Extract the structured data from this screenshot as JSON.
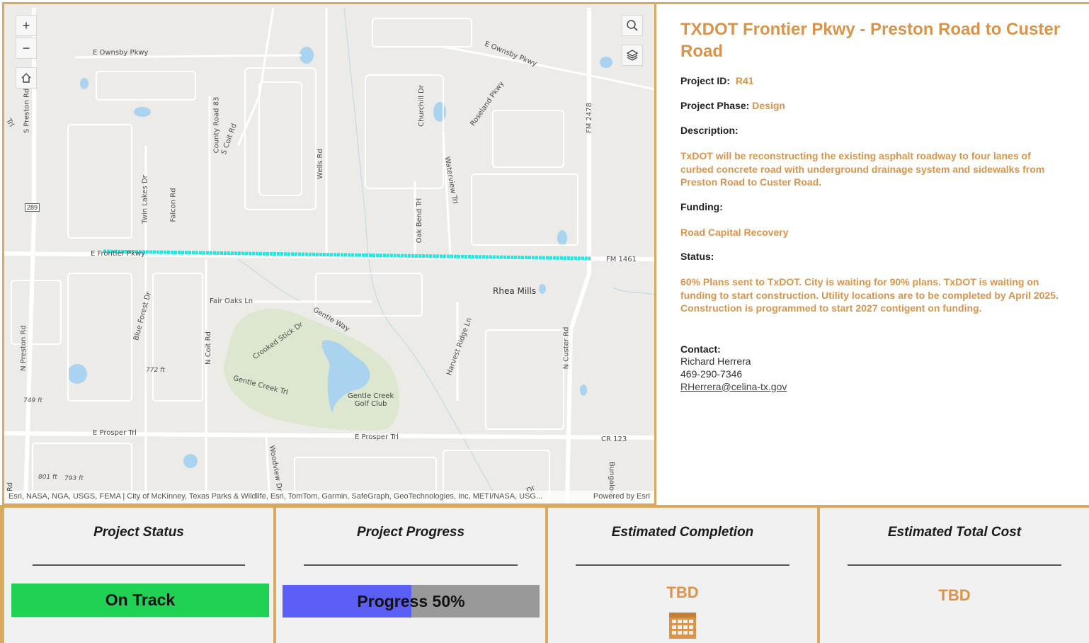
{
  "map": {
    "zoom_in_label": "+",
    "zoom_out_label": "−",
    "labels": {
      "e_ownsby_west": "E Ownsby Pkwy",
      "e_ownsby_east": "E Ownsby Pkwy",
      "s_preston": "S Preston Rd",
      "n_preston": "N Preston Rd",
      "county_road_83": "County Road 83",
      "s_coit": "S Coit Rd",
      "wells": "Wells Rd",
      "churchill": "Churchill Dr",
      "roseland": "Roseland Pkwy",
      "waterview": "Waterview Trl",
      "fm2478": "FM 2478",
      "twin_lakes": "Twin Lakes Dr",
      "falcon": "Falcon Rd",
      "oak_bend": "Oak Bend Trl",
      "e_frontier": "E Frontier Pkwy",
      "fm1461": "FM 1461",
      "rhea_mills": "Rhea Mills",
      "fair_oaks": "Fair Oaks Ln",
      "gentle_way": "Gentle Way",
      "blue_forest": "Blue Forest Dr",
      "harvest_ridge": "Harvest Ridge Ln",
      "n_custer": "N Custer Rd",
      "crooked_stick": "Crooked Stick Dr",
      "n_coit": "N Coit Rd",
      "gentle_creek_trl": "Gentle Creek Trl",
      "golf_club_1": "Gentle Creek",
      "golf_club_2": "Golf Club",
      "elev_772": "772 ft",
      "elev_749": "749 ft",
      "elev_801": "801 ft",
      "elev_793": "793 ft",
      "e_prosper_west": "E Prosper Trl",
      "e_prosper_east": "E Prosper Trl",
      "cr123": "CR 123",
      "woodview": "Woodview Dr",
      "bungalow": "Bungalow",
      "shield_289": "289",
      "trl_edge": "Trl",
      "rd_edge": "Rd",
      "dr_edge": "Dr"
    },
    "attribution_left": "Esri, NASA, NGA, USGS, FEMA | City of McKinney, Texas Parks & Wildlife, Esri, TomTom, Garmin, SafeGraph, GeoTechnologies, Inc, METI/NASA, USG...",
    "attribution_right": "Powered by Esri"
  },
  "details": {
    "title": "TXDOT Frontier Pkwy - Preston Road to Custer Road",
    "project_id_label": "Project ID:",
    "project_id": "R41",
    "phase_label": "Project Phase:",
    "phase": "Design",
    "description_label": "Description:",
    "description": "TxDOT will be reconstructing the existing asphalt roadway to four lanes of curbed concrete road with underground drainage system and sidewalks from Preston Road to Custer Road.",
    "funding_label": "Funding:",
    "funding": "Road Capital Recovery",
    "status_label": "Status:",
    "status": "60% Plans sent to TxDOT. City is waiting for 90% plans. TxDOT is waiting on funding to start construction. Utility locations are to be completed by April 2025. Construction is programmed to start 2027 contigent on funding.",
    "contact_label": "Contact:",
    "contact_name": "Richard Herrera",
    "contact_phone": "469-290-7346",
    "contact_email": "RHerrera@celina-tx.gov"
  },
  "cards": {
    "status": {
      "title": "Project Status",
      "value": "On Track",
      "color": "#1fd253"
    },
    "progress": {
      "title": "Project Progress",
      "label": "Progress 50%",
      "percent": 50
    },
    "completion": {
      "title": "Estimated Completion",
      "value": "TBD",
      "icon": "calendar-icon"
    },
    "cost": {
      "title": "Estimated Total Cost",
      "value": "TBD"
    }
  },
  "colors": {
    "accent": "#d8944a",
    "border": "#d8a95e",
    "route": "#22e6e0",
    "progress_fill": "#5b5ff5"
  }
}
